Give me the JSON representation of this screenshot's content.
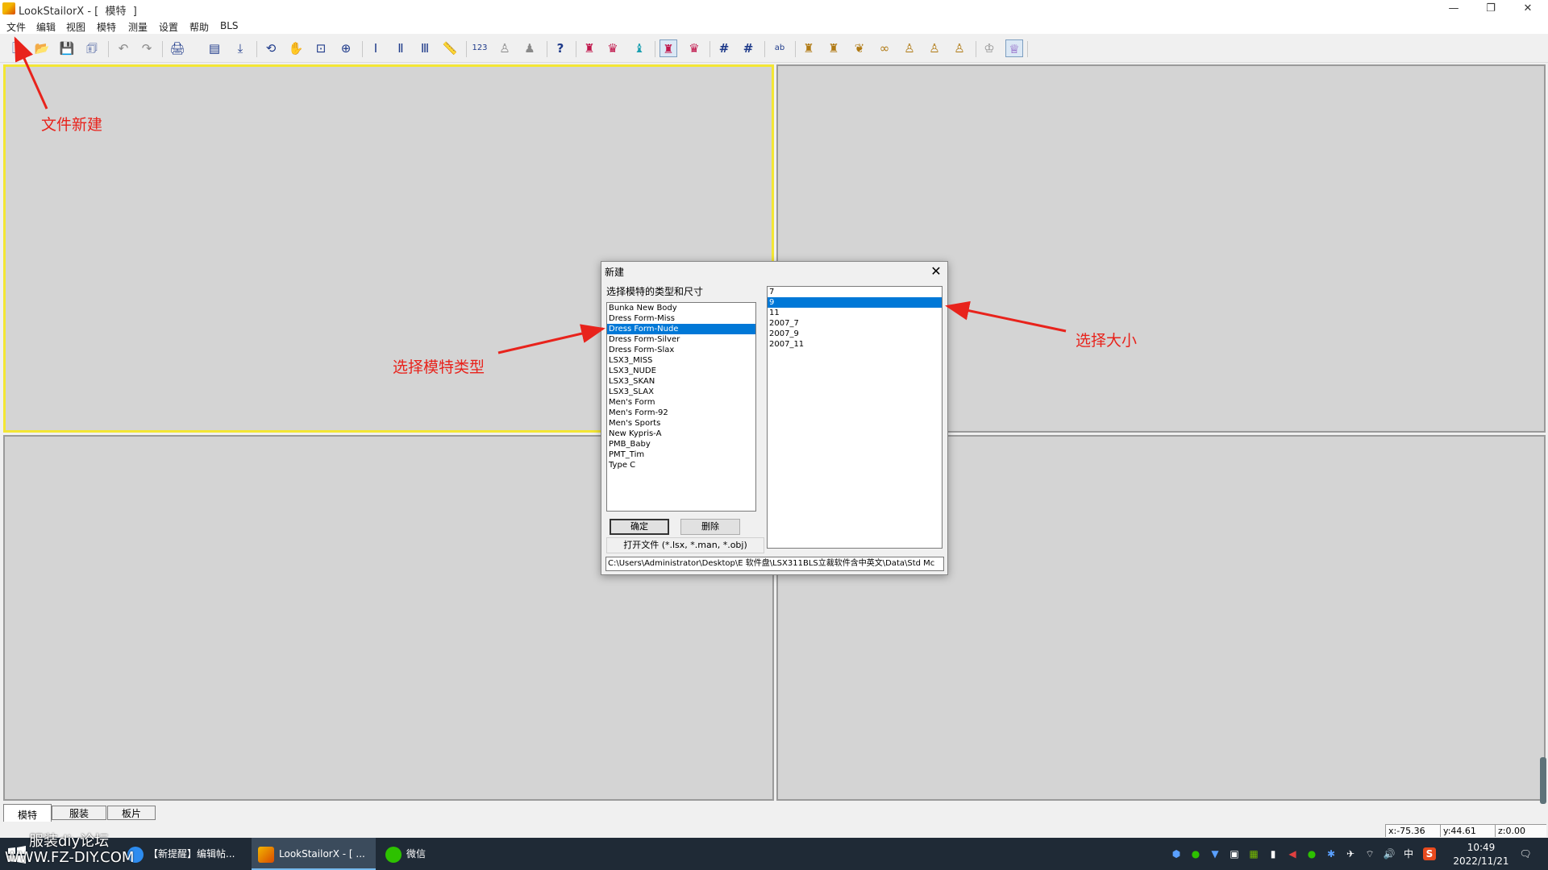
{
  "window": {
    "title": "LookStailorX - [  模特  ]",
    "controls": {
      "minimize": "—",
      "maximize": "❐",
      "close": "✕"
    }
  },
  "menu": [
    "文件",
    "编辑",
    "视图",
    "模特",
    "测量",
    "设置",
    "帮助",
    "BLS"
  ],
  "toolbar": {
    "icons": [
      "new-file-icon",
      "open-folder-icon",
      "save-icon",
      "save-as-icon",
      "undo-icon",
      "redo-icon",
      "print-icon",
      "window-icon",
      "export-icon",
      "rotate-icon",
      "pan-hand-icon",
      "zoom-window-icon",
      "zoom-icon",
      "measure-vertical-icon",
      "measure-vertical-alt-icon",
      "measure-levels-icon",
      "ruler-icon",
      "number-icon",
      "body-front-icon",
      "body-back-icon",
      "help-icon",
      "dress-red-icon",
      "dress-red-alt-icon",
      "dress-cyan-icon",
      "skirt-red-icon",
      "top-red-icon",
      "grid-icon",
      "grid-fine-icon",
      "text-label-icon",
      "torso-icon",
      "torso-alt-icon",
      "bust-icon",
      "ring-icon",
      "figure-icon",
      "figure-alt-icon",
      "figure-full-icon",
      "shirt-icon",
      "dress-form-icon"
    ],
    "glyphs": [
      "🗋",
      "📂",
      "💾",
      "🗊",
      "↶",
      "↷",
      "🖨",
      "▤",
      "⤓",
      "⟲",
      "✋",
      "⊡",
      "⊕",
      "Ⅰ",
      "Ⅱ",
      "Ⅲ",
      "📏",
      "123",
      "♙",
      "♟",
      "?",
      "♜",
      "♛",
      "♝",
      "♜",
      "♛",
      "#",
      "#",
      "ab",
      "♜",
      "♜",
      "❦",
      "∞",
      "♙",
      "♙",
      "♙",
      "♔",
      "♕"
    ]
  },
  "tabs": [
    "模特",
    "服装",
    "板片"
  ],
  "status": {
    "x": "x:-75.36",
    "y": "y:44.61",
    "z": "z:0.00"
  },
  "taskbar": {
    "items": [
      "【新提醒】编辑帖...",
      "LookStailorX - [ ...",
      "微信"
    ],
    "time": "10:49",
    "date": "2022/11/21",
    "tray_glyphs": [
      "⬢",
      "●",
      "▼",
      "▣",
      "▦",
      "▮",
      "◀",
      "●",
      "✱",
      "✈",
      "⌔",
      "🔊",
      "中",
      "S",
      "🗨"
    ],
    "ime": "中"
  },
  "watermark": {
    "cn": "服装diy论坛",
    "en": "WWW.FZ-DIY.COM"
  },
  "dialog": {
    "title": "新建",
    "prompt": "选择模特的类型和尺寸",
    "model_types": [
      "Bunka New Body",
      "Dress Form-Miss",
      "Dress Form-Nude",
      "Dress Form-Silver",
      "Dress Form-Slax",
      "LSX3_MISS",
      "LSX3_NUDE",
      "LSX3_SKAN",
      "LSX3_SLAX",
      "Men's Form",
      "Men's Form-92",
      "Men's Sports",
      "New Kypris-A",
      "PMB_Baby",
      "PMT_Tim",
      "Type C"
    ],
    "selected_type": "Dress Form-Nude",
    "sizes": [
      "7",
      "9",
      "11",
      "2007_7",
      "2007_9",
      "2007_11"
    ],
    "selected_size": "9",
    "ok_label": "确定",
    "delete_label": "删除",
    "open_file_label": "打开文件 (*.lsx, *.man, *.obj)",
    "path": "C:\\Users\\Administrator\\Desktop\\E 软件盘\\LSX311BLS立裁软件含中英文\\Data\\Std Mc"
  },
  "annotations": {
    "new_file": "文件新建",
    "choose_type": "选择模特类型",
    "choose_size": "选择大小",
    "color": "#e8231c"
  }
}
